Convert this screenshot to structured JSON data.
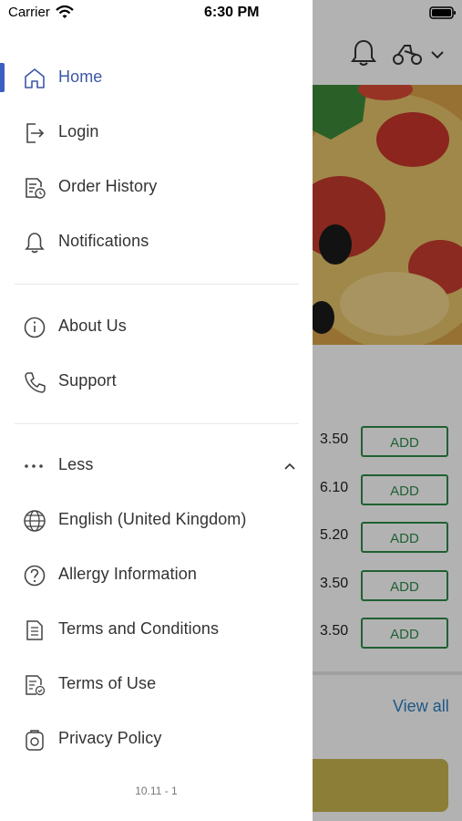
{
  "status": {
    "carrier": "Carrier",
    "time": "6:30 PM"
  },
  "menu": {
    "primary": [
      {
        "label": "Home",
        "icon": "home-icon",
        "active": true
      },
      {
        "label": "Login",
        "icon": "login-icon"
      },
      {
        "label": "Order History",
        "icon": "order-history-icon"
      },
      {
        "label": "Notifications",
        "icon": "bell-icon"
      }
    ],
    "secondary": [
      {
        "label": "About Us",
        "icon": "info-icon"
      },
      {
        "label": "Support",
        "icon": "phone-icon"
      }
    ],
    "less_label": "Less",
    "more": [
      {
        "label": "English (United Kingdom)",
        "icon": "globe-icon"
      },
      {
        "label": "Allergy Information",
        "icon": "question-icon"
      },
      {
        "label": "Terms and Conditions",
        "icon": "document-icon"
      },
      {
        "label": "Terms of Use",
        "icon": "document-check-icon"
      },
      {
        "label": "Privacy Policy",
        "icon": "privacy-icon"
      }
    ]
  },
  "version": "10.11 - 1",
  "background": {
    "prices": [
      "3.50",
      "6.10",
      "5.20",
      "3.50",
      "3.50"
    ],
    "add_label": "ADD",
    "view_all": "View all"
  },
  "colors": {
    "active": "#3c57a8",
    "indicator": "#3e5fc2",
    "add_green": "#2f8a4a",
    "link_blue": "#2a7fc1"
  }
}
